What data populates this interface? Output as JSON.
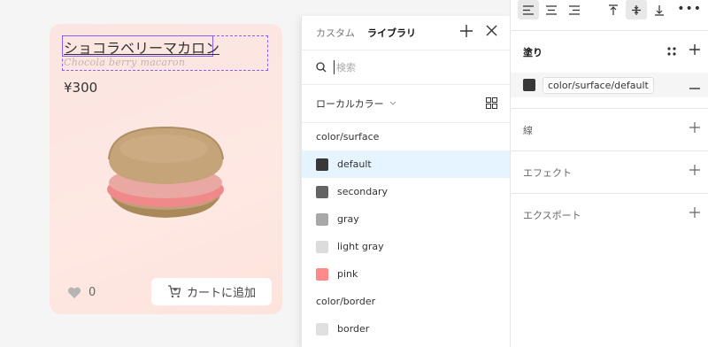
{
  "card": {
    "title": "ショコラベリーマカロン",
    "subtitle": "Chocola berry macaron",
    "price": "¥300",
    "like_count": "0",
    "cart_label": "カートに追加"
  },
  "library": {
    "tabs": [
      "カスタム",
      "ライブラリ"
    ],
    "search_placeholder": "検索",
    "local_label": "ローカルカラー",
    "groups": [
      {
        "label": "color/surface",
        "items": [
          {
            "name": "default",
            "color": "#383838"
          },
          {
            "name": "secondary",
            "color": "#646464"
          },
          {
            "name": "gray",
            "color": "#a8a8a8"
          },
          {
            "name": "light gray",
            "color": "#dcdcdc"
          },
          {
            "name": "pink",
            "color": "#ff8a8a"
          }
        ]
      },
      {
        "label": "color/border",
        "items": [
          {
            "name": "border",
            "color": "#e0e0e0"
          }
        ]
      }
    ]
  },
  "props": {
    "fill_label": "塗り",
    "fill_value": "color/surface/default",
    "stroke_label": "線",
    "effect_label": "エフェクト",
    "export_label": "エクスポート"
  }
}
